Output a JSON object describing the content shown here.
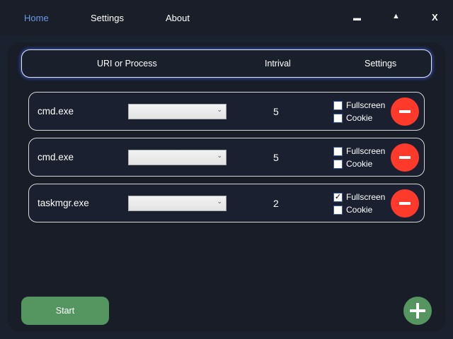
{
  "nav": {
    "home": "Home",
    "settings": "Settings",
    "about": "About",
    "home_color": "#6a9ae8"
  },
  "window_controls": {
    "minimize": "▬",
    "maximize": "▲",
    "close": "X"
  },
  "header": {
    "uri": "URI or Process",
    "interval": "Intrival",
    "settings": "Settings"
  },
  "rows": [
    {
      "name": "cmd.exe",
      "interval": "5",
      "fullscreen": false,
      "cookie": false
    },
    {
      "name": "cmd.exe",
      "interval": "5",
      "fullscreen": false,
      "cookie": false
    },
    {
      "name": "taskmgr.exe",
      "interval": "2",
      "fullscreen": true,
      "cookie": false
    }
  ],
  "labels": {
    "fullscreen": "Fullscreen",
    "cookie": "Cookie",
    "chevron": "⌄",
    "check": "✓"
  },
  "start": "Start"
}
